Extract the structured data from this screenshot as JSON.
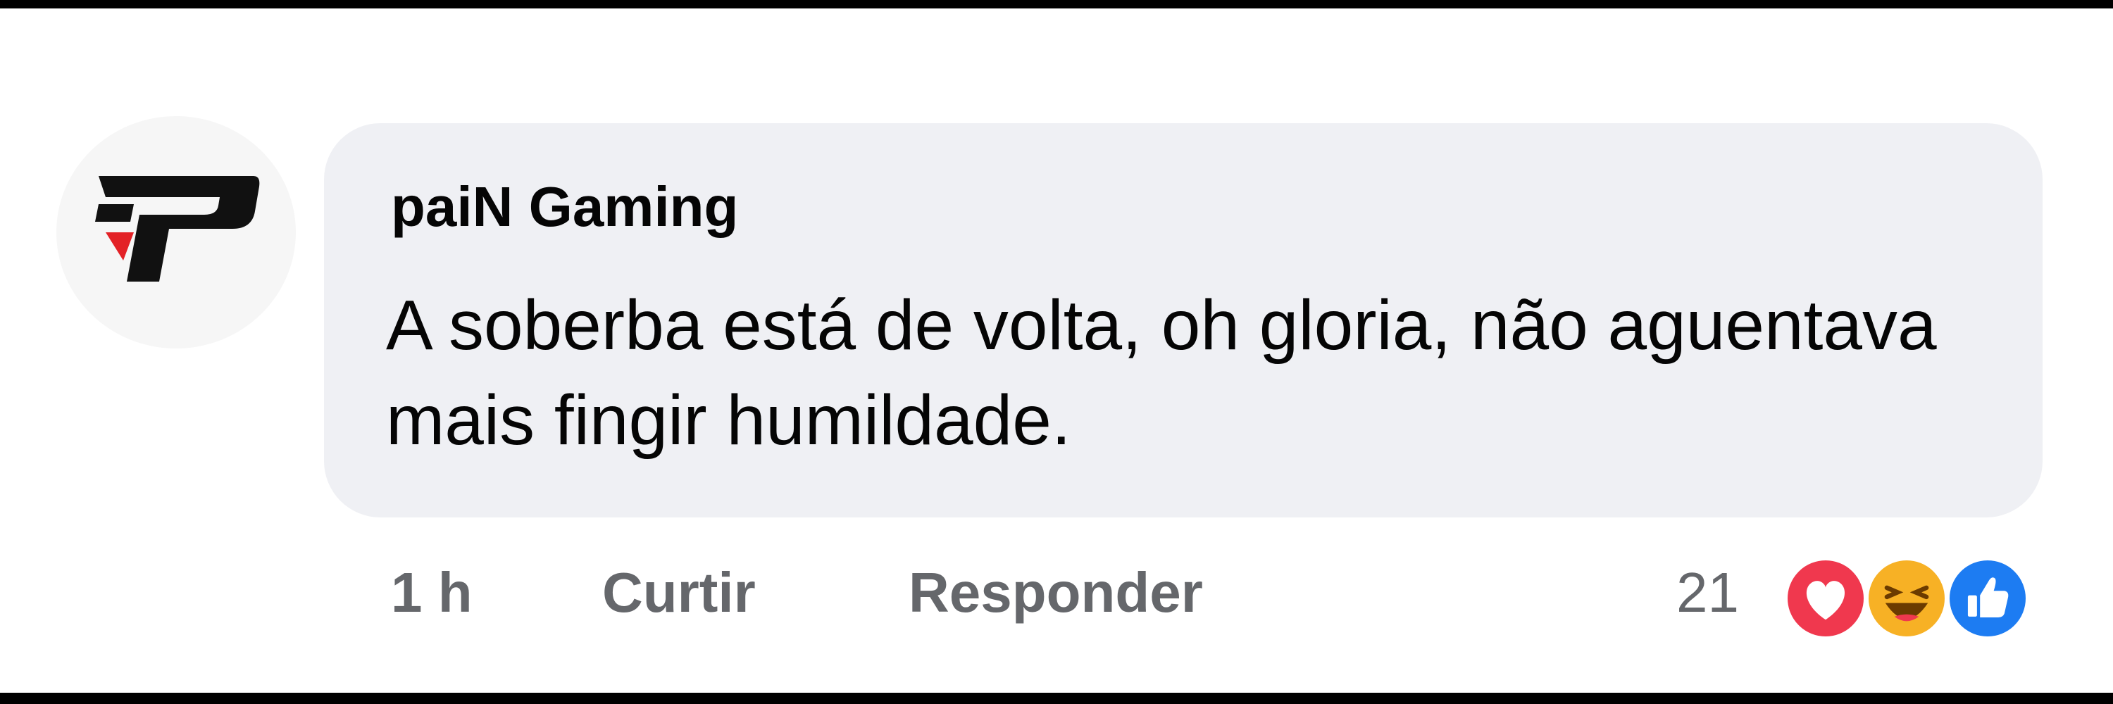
{
  "comment": {
    "author": "paiN Gaming",
    "text": "A soberba está de volta, oh gloria, não aguentava mais fingir humildade.",
    "timestamp": "1 h",
    "actions": {
      "like_label": "Curtir",
      "reply_label": "Responder"
    },
    "reactions": {
      "count": "21",
      "types": [
        "love-icon",
        "haha-icon",
        "like-icon"
      ]
    }
  },
  "colors": {
    "bubble": "#eff0f4",
    "text": "#050505",
    "meta_text": "#65676b",
    "love": "#f0384e",
    "haha": "#f7b125",
    "like": "#1d7cf2",
    "logo_black": "#111111",
    "logo_red": "#e32126"
  }
}
